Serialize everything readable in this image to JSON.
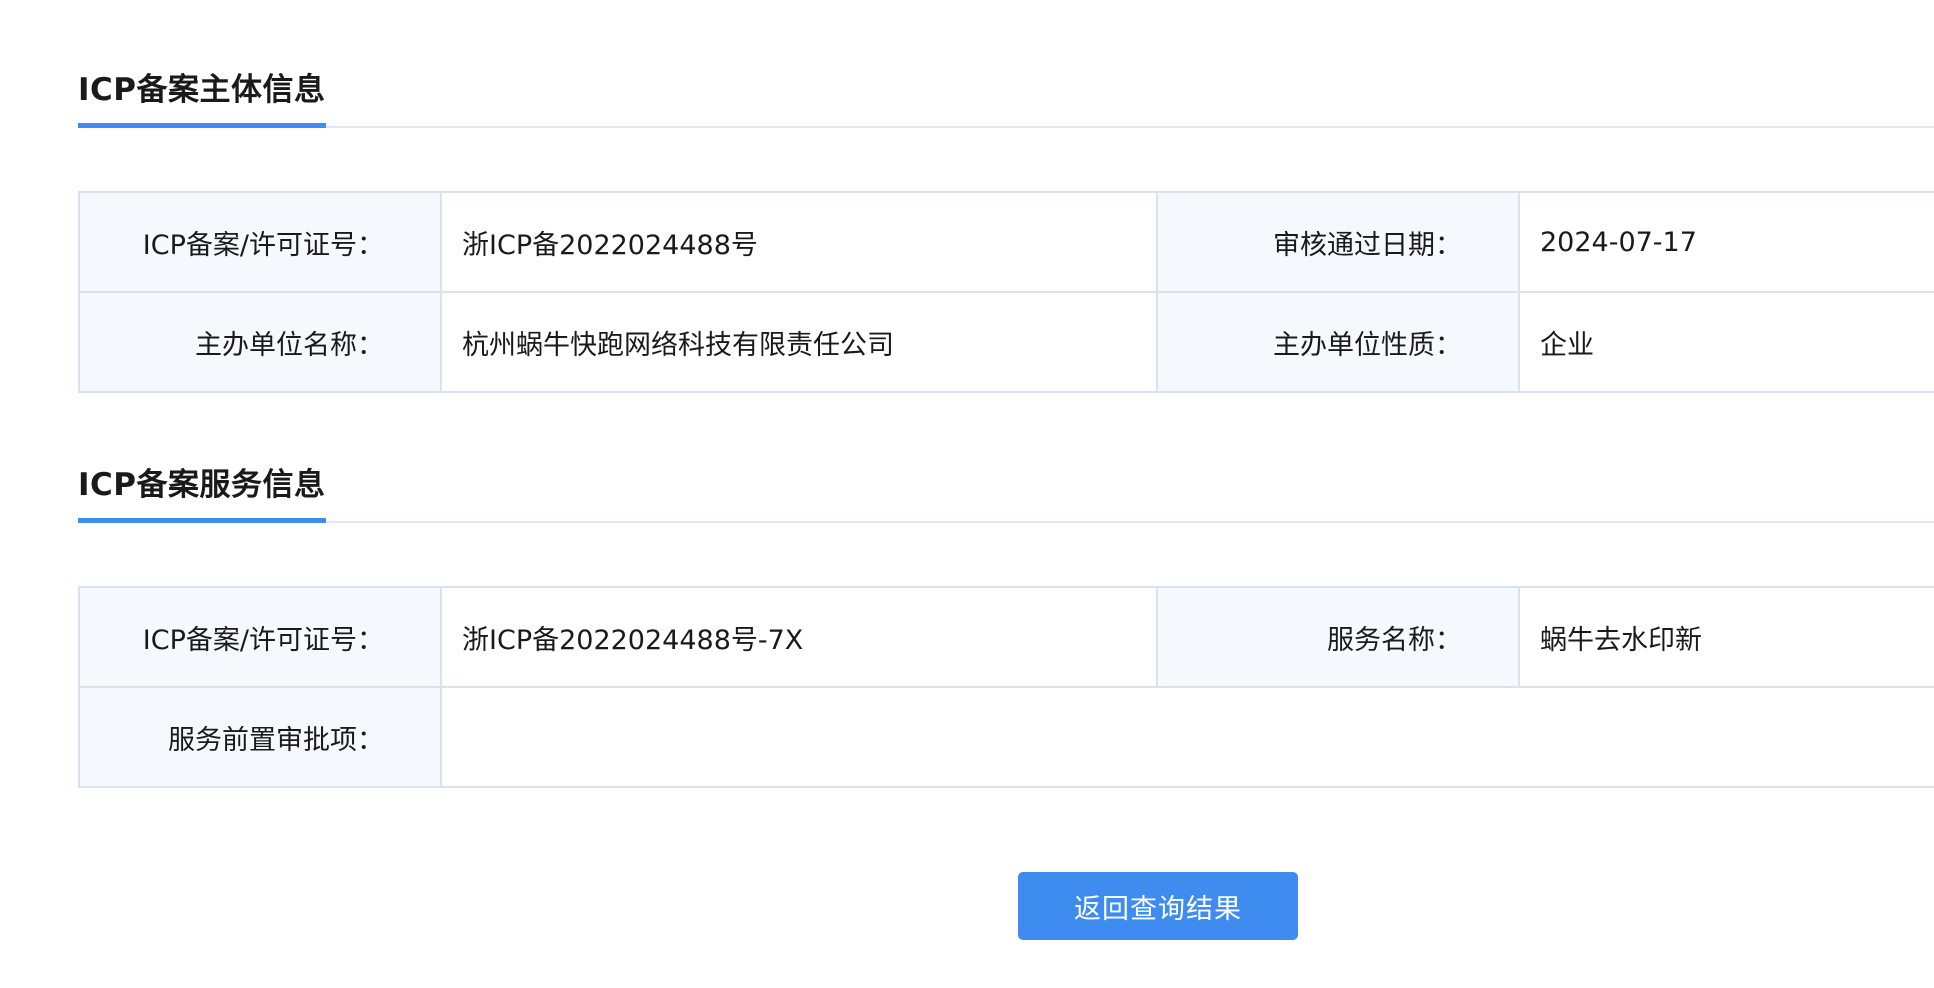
{
  "subject_section": {
    "title": "ICP备案主体信息",
    "rows": [
      {
        "label1": "ICP备案/许可证号：",
        "value1": "浙ICP备2022024488号",
        "label2": "审核通过日期：",
        "value2": "2024-07-17"
      },
      {
        "label1": "主办单位名称：",
        "value1": "杭州蜗牛快跑网络科技有限责任公司",
        "label2": "主办单位性质：",
        "value2": "企业"
      }
    ]
  },
  "service_section": {
    "title": "ICP备案服务信息",
    "rows": [
      {
        "label1": "ICP备案/许可证号：",
        "value1": "浙ICP备2022024488号-7X",
        "label2": "服务名称：",
        "value2": "蜗牛去水印新"
      },
      {
        "label1": "服务前置审批项：",
        "value1": ""
      }
    ]
  },
  "back_button_label": "返回查询结果",
  "colors": {
    "accent": "#3f8cf0",
    "label_bg": "#f5f8fc",
    "border": "#d9e3ee"
  }
}
